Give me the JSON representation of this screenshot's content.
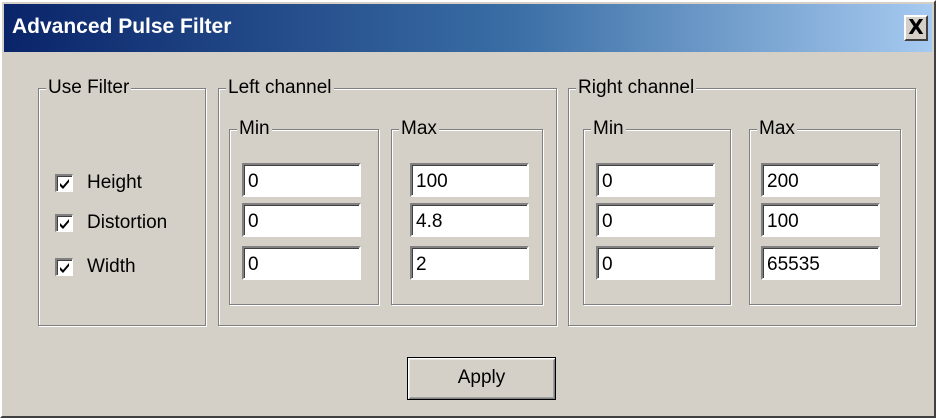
{
  "window": {
    "title": "Advanced Pulse Filter",
    "close_symbol": "X"
  },
  "use_filter": {
    "legend": "Use Filter",
    "items": [
      {
        "label": "Height",
        "checked": true
      },
      {
        "label": "Distortion",
        "checked": true
      },
      {
        "label": "Width",
        "checked": true
      }
    ]
  },
  "left_channel": {
    "legend": "Left channel",
    "min": {
      "legend": "Min",
      "values": [
        "0",
        "0",
        "0"
      ]
    },
    "max": {
      "legend": "Max",
      "values": [
        "100",
        "4.8",
        "2"
      ]
    }
  },
  "right_channel": {
    "legend": "Right channel",
    "min": {
      "legend": "Min",
      "values": [
        "0",
        "0",
        "0"
      ]
    },
    "max": {
      "legend": "Max",
      "values": [
        "200",
        "100",
        "65535"
      ]
    }
  },
  "apply_label": "Apply",
  "colors": {
    "face": "#d4d0c8",
    "title_start": "#0a246a",
    "title_end": "#a6caf0"
  },
  "icons": {
    "close": "close-icon",
    "check": "checkmark-icon"
  }
}
